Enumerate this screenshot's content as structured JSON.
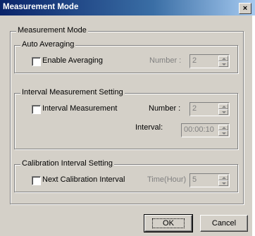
{
  "window": {
    "title": "Measurement Mode",
    "close_glyph": "×"
  },
  "main_group": {
    "label": "Measurement Mode"
  },
  "auto_averaging": {
    "label": "Auto Averaging",
    "checkbox_label": "Enable Averaging",
    "checked": false,
    "number_label": "Number :",
    "number_value": "2"
  },
  "interval_setting": {
    "label": "Interval Measurement Setting",
    "checkbox_label": "Interval Measurement",
    "checked": false,
    "number_label": "Number :",
    "number_value": "2",
    "interval_label": "Interval:",
    "interval_value": "00:00:10"
  },
  "calibration_setting": {
    "label": "Calibration Interval Setting",
    "checkbox_label": "Next Calibration Interval",
    "checked": false,
    "time_label": "Time(Hour)",
    "time_value": "5"
  },
  "buttons": {
    "ok": "OK",
    "cancel": "Cancel"
  }
}
